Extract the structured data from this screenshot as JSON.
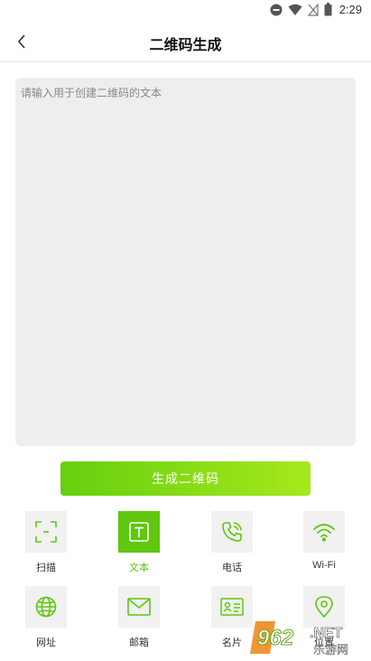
{
  "status_bar": {
    "time": "2:29",
    "icons": [
      "do-not-disturb-icon",
      "wifi-icon",
      "no-signal-icon",
      "battery-icon"
    ]
  },
  "header": {
    "title": "二维码生成",
    "back_icon": "chevron-left-icon"
  },
  "input": {
    "placeholder": "请输入用于创建二维码的文本",
    "value": ""
  },
  "generate_button": {
    "label": "生成二维码"
  },
  "types": [
    {
      "label": "扫描",
      "icon": "scan-icon",
      "active": false
    },
    {
      "label": "文本",
      "icon": "text-icon",
      "active": true
    },
    {
      "label": "电话",
      "icon": "phone-icon",
      "active": false
    },
    {
      "label": "Wi-Fi",
      "icon": "wifi-icon",
      "active": false
    },
    {
      "label": "网址",
      "icon": "globe-icon",
      "active": false
    },
    {
      "label": "邮箱",
      "icon": "mail-icon",
      "active": false
    },
    {
      "label": "名片",
      "icon": "contact-card-icon",
      "active": false
    },
    {
      "label": "位置",
      "icon": "location-pin-icon",
      "active": false
    }
  ],
  "watermark": {
    "logo_text": "962",
    "logo_suffix": ".NET",
    "tagline": "乐游网"
  },
  "colors": {
    "accent": "#5ec70e",
    "button_gradient_start": "#66cf10",
    "button_gradient_end": "#a6e81c",
    "tile_bg": "#f1f1f1",
    "input_bg": "#eeeeee"
  }
}
